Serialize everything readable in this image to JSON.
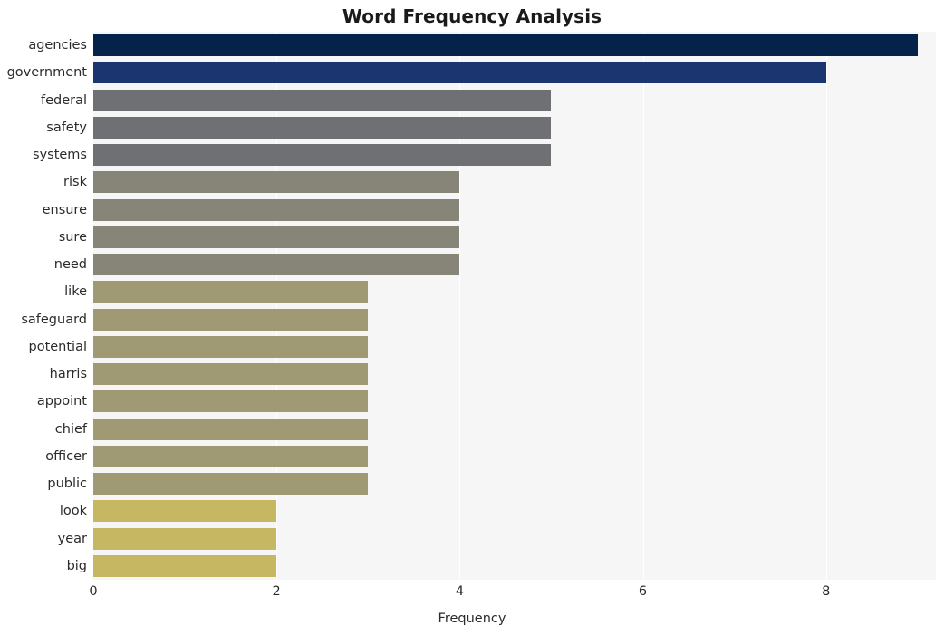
{
  "chart_data": {
    "type": "bar",
    "orientation": "horizontal",
    "title": "Word Frequency Analysis",
    "xlabel": "Frequency",
    "ylabel": "",
    "xlim": [
      0,
      9.2
    ],
    "xticks": [
      0,
      2,
      4,
      6,
      8
    ],
    "xtick_labels": [
      "0",
      "2",
      "4",
      "6",
      "8"
    ],
    "grid": true,
    "grid_axis": "x",
    "grid_color": "#ffffff",
    "plot_background": "#f6f6f7",
    "figure_background": "#ffffff",
    "legend": null,
    "categories": [
      "agencies",
      "government",
      "federal",
      "safety",
      "systems",
      "risk",
      "ensure",
      "sure",
      "need",
      "like",
      "safeguard",
      "potential",
      "harris",
      "appoint",
      "chief",
      "officer",
      "public",
      "look",
      "year",
      "big"
    ],
    "values": [
      9,
      8,
      5,
      5,
      5,
      4,
      4,
      4,
      4,
      3,
      3,
      3,
      3,
      3,
      3,
      3,
      3,
      2,
      2,
      2
    ],
    "bar_colors": [
      "#05224a",
      "#1b3571",
      "#6e7074",
      "#6e7074",
      "#6e7074",
      "#878578",
      "#878578",
      "#878578",
      "#878578",
      "#a09a74",
      "#a09a74",
      "#a09a74",
      "#a09a74",
      "#a09a74",
      "#a09a74",
      "#a09a74",
      "#a09a74",
      "#c6b763",
      "#c6b763",
      "#c6b763"
    ]
  }
}
